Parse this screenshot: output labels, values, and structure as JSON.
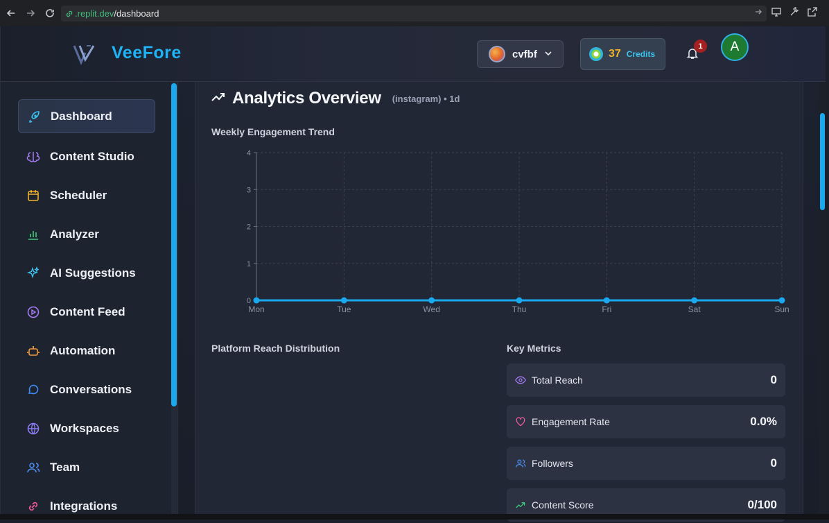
{
  "browser": {
    "url_host_prefix": ".replit.dev",
    "url_path": "/dashboard"
  },
  "header": {
    "brand": "VeeFore",
    "workspace_name": "cvfbf",
    "credits_count": "37",
    "credits_label": "Credits",
    "notification_count": "1",
    "user_initial": "A"
  },
  "sidebar": {
    "items": [
      {
        "label": "Dashboard",
        "icon": "rocket-icon",
        "color": "#3cc3f0"
      },
      {
        "label": "Content Studio",
        "icon": "brain-icon",
        "color": "#a77bf3"
      },
      {
        "label": "Scheduler",
        "icon": "calendar-icon",
        "color": "#f2b230"
      },
      {
        "label": "Analyzer",
        "icon": "bar-chart-icon",
        "color": "#3ccf7a"
      },
      {
        "label": "AI Suggestions",
        "icon": "sparkles-icon",
        "color": "#3cc3f0"
      },
      {
        "label": "Content Feed",
        "icon": "play-circle-icon",
        "color": "#a77bf3"
      },
      {
        "label": "Automation",
        "icon": "bot-icon",
        "color": "#f29a3a"
      },
      {
        "label": "Conversations",
        "icon": "chat-icon",
        "color": "#3f8ef7"
      },
      {
        "label": "Workspaces",
        "icon": "globe-icon",
        "color": "#8b7cf6"
      },
      {
        "label": "Team",
        "icon": "users-icon",
        "color": "#4f8ef0"
      },
      {
        "label": "Integrations",
        "icon": "link-icon",
        "color": "#ef5b9c"
      }
    ]
  },
  "main": {
    "title": "Analytics Overview",
    "subtitle": "(instagram) • 1d",
    "weekly_label": "Weekly Engagement Trend",
    "reach_label": "Platform Reach Distribution",
    "metrics_label": "Key Metrics",
    "metrics": [
      {
        "label": "Total Reach",
        "value": "0",
        "icon": "eye-icon",
        "color": "#a77bf3"
      },
      {
        "label": "Engagement Rate",
        "value": "0.0%",
        "icon": "heart-icon",
        "color": "#ef5b9c"
      },
      {
        "label": "Followers",
        "value": "0",
        "icon": "users-icon",
        "color": "#4f8ef0"
      },
      {
        "label": "Content Score",
        "value": "0/100",
        "icon": "trending-up-icon",
        "color": "#3ccf7a"
      }
    ]
  },
  "chart_data": {
    "type": "line",
    "categories": [
      "Mon",
      "Tue",
      "Wed",
      "Thu",
      "Fri",
      "Sat",
      "Sun"
    ],
    "series": [
      {
        "values": [
          0,
          0,
          0,
          0,
          0,
          0,
          0
        ]
      }
    ],
    "yticks": [
      0,
      1,
      2,
      3,
      4
    ],
    "ylim": [
      0,
      4
    ],
    "grid": true,
    "color": "#1aa9ee"
  }
}
